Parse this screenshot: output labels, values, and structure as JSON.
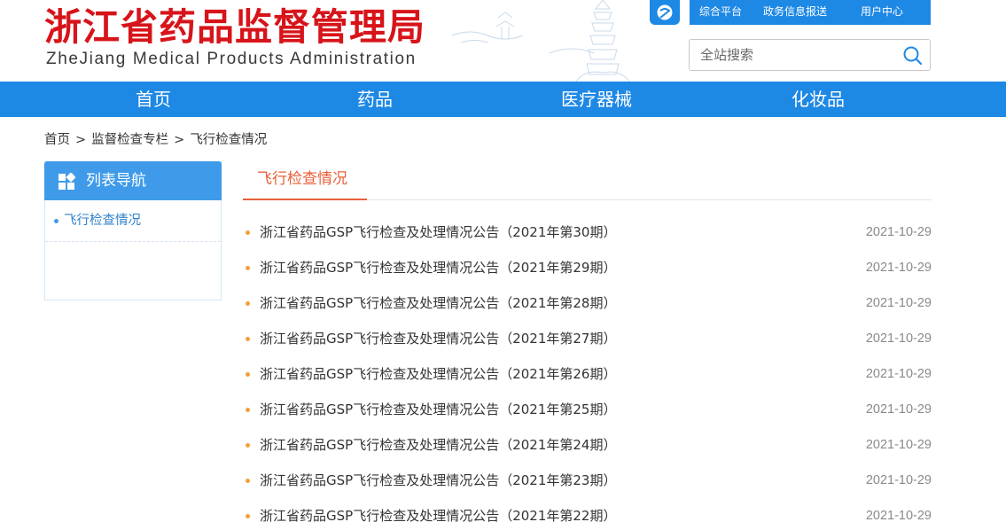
{
  "header": {
    "logo_cn": "浙江省药品监督管理局",
    "logo_en": "ZheJiang Medical Products Administration",
    "top_links": [
      "综合平台",
      "政务信息报送",
      "用户中心"
    ],
    "search_placeholder": "全站搜索",
    "brand_color": "#d7141a",
    "accent_color": "#1e88e5"
  },
  "nav": {
    "items": [
      "首页",
      "药品",
      "医疗器械",
      "化妆品"
    ]
  },
  "breadcrumb": {
    "items": [
      "首页",
      "监督检查专栏",
      "飞行检查情况"
    ],
    "separator": ">"
  },
  "sidebar": {
    "title": "列表导航",
    "items": [
      "飞行检查情况"
    ]
  },
  "main": {
    "tab_label": "飞行检查情况",
    "tab_color": "#e8603a",
    "list": [
      {
        "title": "浙江省药品GSP飞行检查及处理情况公告（2021年第30期）",
        "date": "2021-10-29"
      },
      {
        "title": "浙江省药品GSP飞行检查及处理情况公告（2021年第29期）",
        "date": "2021-10-29"
      },
      {
        "title": "浙江省药品GSP飞行检查及处理情况公告（2021年第28期）",
        "date": "2021-10-29"
      },
      {
        "title": "浙江省药品GSP飞行检查及处理情况公告（2021年第27期）",
        "date": "2021-10-29"
      },
      {
        "title": "浙江省药品GSP飞行检查及处理情况公告（2021年第26期）",
        "date": "2021-10-29"
      },
      {
        "title": "浙江省药品GSP飞行检查及处理情况公告（2021年第25期）",
        "date": "2021-10-29"
      },
      {
        "title": "浙江省药品GSP飞行检查及处理情况公告（2021年第24期）",
        "date": "2021-10-29"
      },
      {
        "title": "浙江省药品GSP飞行检查及处理情况公告（2021年第23期）",
        "date": "2021-10-29"
      },
      {
        "title": "浙江省药品GSP飞行检查及处理情况公告（2021年第22期）",
        "date": "2021-10-29"
      }
    ]
  },
  "icons": {
    "app": "app-logo-icon",
    "search": "search-icon",
    "sidebar": "grid-icon"
  }
}
